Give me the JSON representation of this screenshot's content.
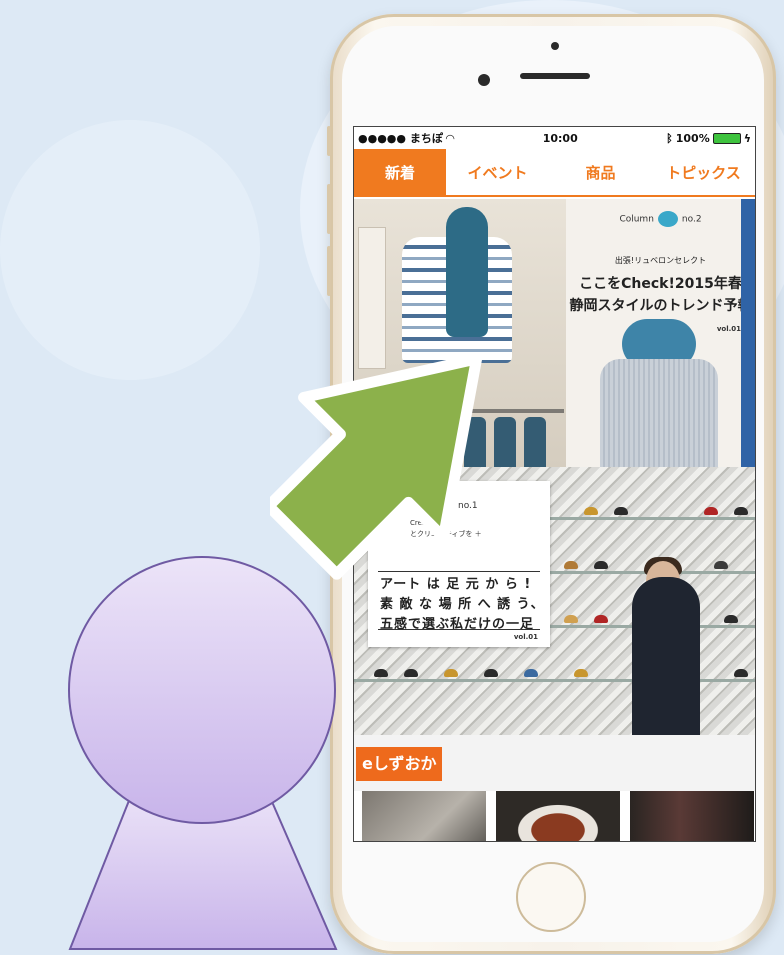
{
  "status_bar": {
    "carrier": "●●●●● まちぽ",
    "time": "10:00",
    "battery": "100%"
  },
  "tabs": [
    {
      "label": "新着",
      "active": true
    },
    {
      "label": "イベント",
      "active": false
    },
    {
      "label": "商品",
      "active": false
    },
    {
      "label": "トピックス",
      "active": false
    }
  ],
  "feature1": {
    "column_label": "Column",
    "column_no": "no.2",
    "subtitle": "出張!リュベロンセレクト",
    "title_line1": "ここをCheck!2015年春",
    "title_line2": "静岡スタイルのトレンド予報",
    "volume": "vol.01"
  },
  "feature2": {
    "column_no": "no.1",
    "creative": "Creative",
    "subtitle": "とクリエイティブを ＋",
    "title_line1": "アート は 足 元 か ら !",
    "title_line2": "素 敵 な 場 所 へ 誘 う、",
    "title_line3": "五感で選ぶ私だけの一足",
    "volume": "vol.01"
  },
  "section": {
    "logo_text": "eしずおか"
  },
  "colors": {
    "accent": "#f07a1f",
    "arrow": "#8cb14b",
    "person": "#d2c2ee"
  }
}
